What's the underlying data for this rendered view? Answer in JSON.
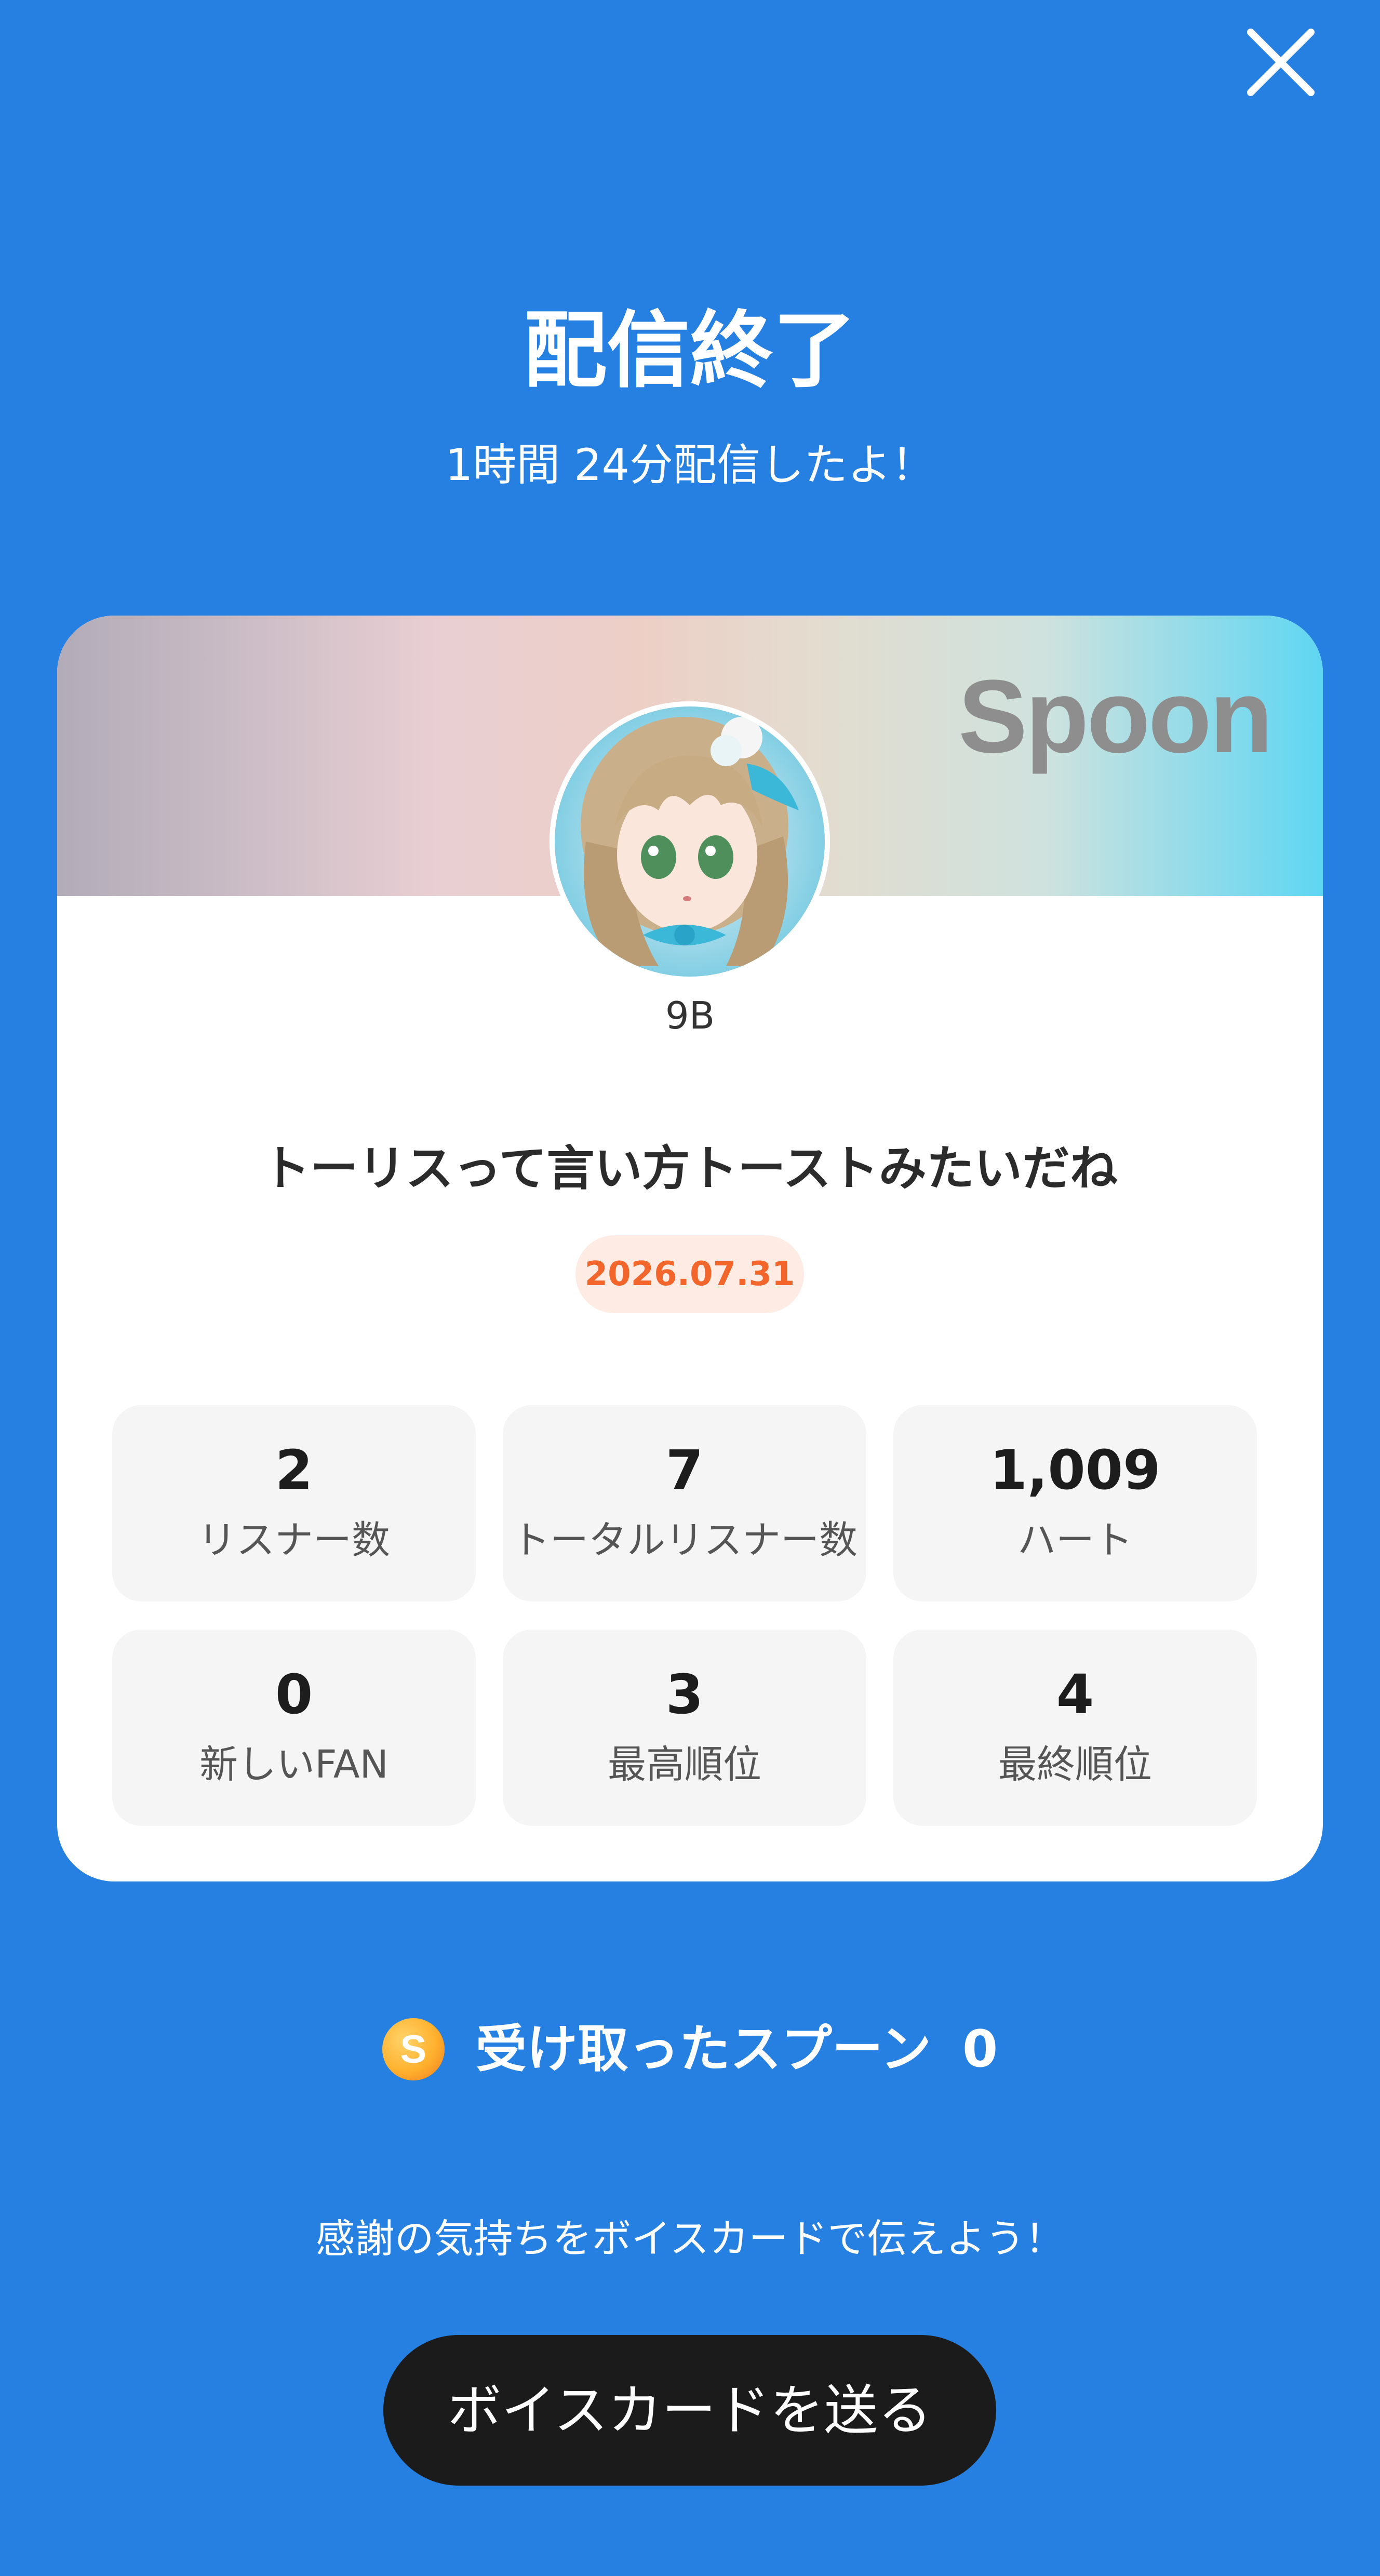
{
  "close_icon": "close-icon",
  "header": {
    "title": "配信終了",
    "subtitle": "1時間 24分配信したよ！"
  },
  "card": {
    "brand": "Spoon",
    "banner_colors": [
      "#b2acb8",
      "#e9cfd3",
      "#cfe2de",
      "#5fd6f2"
    ],
    "username": "9B",
    "stream_title": "トーリスって言い方トーストみたいだね",
    "date": "2026.07.31",
    "stats": [
      {
        "value": "2",
        "label": "リスナー数"
      },
      {
        "value": "7",
        "label": "トータルリスナー数"
      },
      {
        "value": "1,009",
        "label": "ハート"
      },
      {
        "value": "0",
        "label": "新しいFAN"
      },
      {
        "value": "3",
        "label": "最高順位"
      },
      {
        "value": "4",
        "label": "最終順位"
      }
    ]
  },
  "spoons": {
    "coin_letter": "S",
    "label": "受け取ったスプーン",
    "count": "0"
  },
  "footer": {
    "thanks": "感謝の気持ちをボイスカードで伝えよう！",
    "button_label": "ボイスカードを送る"
  },
  "colors": {
    "background": "#2680e2",
    "accent_orange": "#f2652b",
    "button_dark": "#1b1b1b"
  }
}
